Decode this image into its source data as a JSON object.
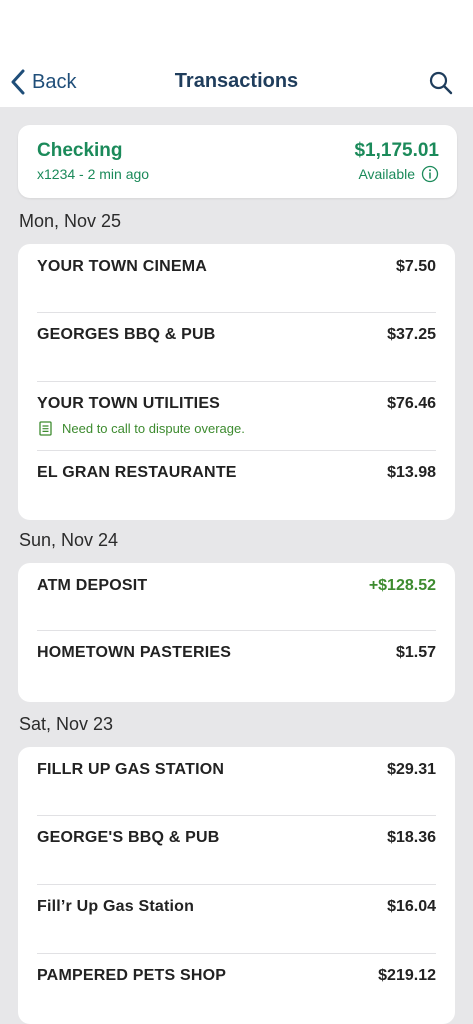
{
  "header": {
    "back_label": "Back",
    "title": "Transactions"
  },
  "account": {
    "name": "Checking",
    "subtitle": "x1234 - 2 min ago",
    "balance": "$1,175.01",
    "available_label": "Available"
  },
  "groups": [
    {
      "date": "Mon, Nov 25",
      "transactions": [
        {
          "name": "YOUR TOWN CINEMA",
          "amount": "$7.50"
        },
        {
          "name": "GEORGES BBQ & PUB",
          "amount": "$37.25"
        },
        {
          "name": "YOUR TOWN UTILITIES",
          "amount": "$76.46",
          "note": "Need to call to dispute overage."
        },
        {
          "name": "EL GRAN RESTAURANTE",
          "amount": "$13.98"
        }
      ]
    },
    {
      "date": "Sun, Nov 24",
      "transactions": [
        {
          "name": "ATM DEPOSIT",
          "amount": "+$128.52"
        },
        {
          "name": "HOMETOWN PASTERIES",
          "amount": "$1.57"
        }
      ]
    },
    {
      "date": "Sat, Nov 23",
      "transactions": [
        {
          "name": "FILLR UP GAS STATION",
          "amount": "$29.31"
        },
        {
          "name": "GEORGE'S BBQ & PUB",
          "amount": "$18.36"
        },
        {
          "name": "Fill’r Up Gas Station",
          "amount": "$16.04"
        },
        {
          "name": "PAMPERED PETS SHOP",
          "amount": "$219.12"
        }
      ]
    }
  ],
  "colors": {
    "brand_green": "#1b8a5a",
    "positive": "#3d8b2f",
    "nav_blue": "#1f4e79"
  },
  "icons": {
    "back": "chevron-left-icon",
    "search": "search-icon",
    "info": "info-icon",
    "note": "note-icon"
  }
}
